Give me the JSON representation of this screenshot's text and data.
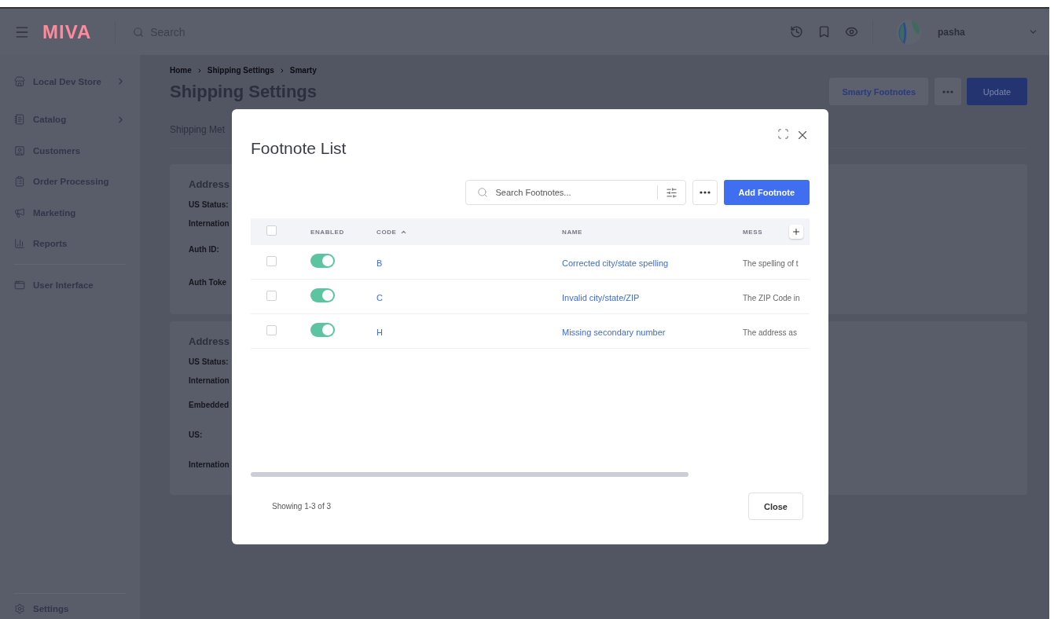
{
  "header": {
    "logo": "MIVA",
    "search_placeholder": "Search",
    "user": "pasha"
  },
  "sidebar": {
    "store": {
      "label": "Local Dev Store",
      "expandable": true
    },
    "items": [
      {
        "label": "Catalog",
        "expandable": true
      },
      {
        "label": "Customers",
        "expandable": false
      },
      {
        "label": "Order Processing",
        "expandable": false
      },
      {
        "label": "Marketing",
        "expandable": false
      },
      {
        "label": "Reports",
        "expandable": false
      }
    ],
    "secondary": [
      {
        "label": "User Interface",
        "expandable": false
      }
    ],
    "footer": {
      "label": "Settings"
    }
  },
  "page": {
    "breadcrumbs": [
      "Home",
      "Shipping Settings",
      "Smarty"
    ],
    "title": "Shipping Settings",
    "actions": {
      "secondary": "Smarty Footnotes",
      "primary": "Update"
    },
    "tab": "Shipping Met",
    "cards": [
      {
        "title": "Address",
        "fields": [
          "US Status:",
          "Internation",
          "Auth ID:",
          "Auth Toke"
        ]
      },
      {
        "title": "Address",
        "fields": [
          "US Status:",
          "Internation",
          "Embedded",
          "US:",
          "Internation"
        ]
      }
    ]
  },
  "modal": {
    "title": "Footnote List",
    "search_placeholder": "Search Footnotes...",
    "add_button": "Add Footnote",
    "header_checked": false,
    "columns": [
      {
        "label": "ENABLED",
        "sorted": false
      },
      {
        "label": "CODE",
        "sorted": true
      },
      {
        "label": "NAME",
        "sorted": false
      },
      {
        "label": "MESS",
        "sorted": false
      }
    ],
    "rows": [
      {
        "checked": false,
        "enabled": true,
        "code": "B",
        "name": "Corrected city/state spelling",
        "message": "The spelling of t"
      },
      {
        "checked": false,
        "enabled": true,
        "code": "C",
        "name": "Invalid city/state/ZIP",
        "message": "The ZIP Code in"
      },
      {
        "checked": false,
        "enabled": true,
        "code": "H",
        "name": "Missing secondary number",
        "message": "The address as"
      }
    ],
    "status": "Showing 1-3 of 3",
    "close_button": "Close"
  }
}
